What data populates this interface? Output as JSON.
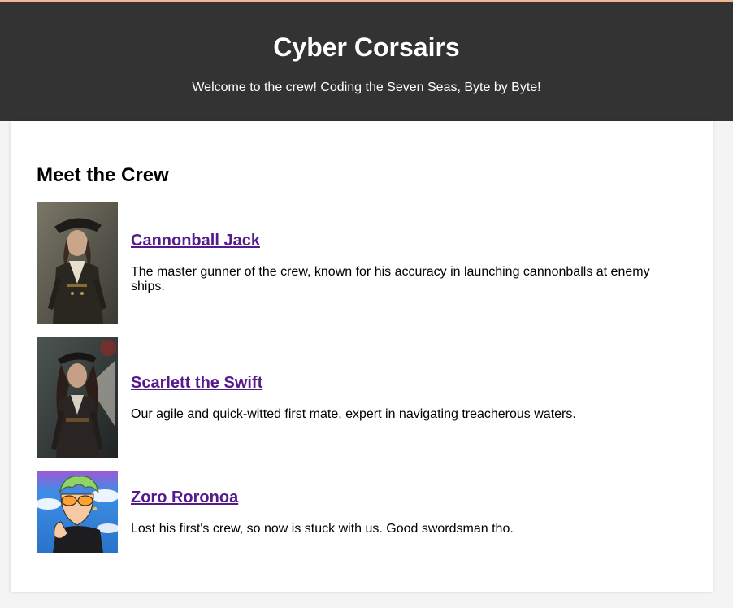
{
  "header": {
    "title": "Cyber Corsairs",
    "tagline": "Welcome to the crew! Coding the Seven Seas, Byte by Byte!"
  },
  "main": {
    "heading": "Meet the Crew",
    "members": [
      {
        "name": "Cannonball Jack",
        "description": "The master gunner of the crew, known for his accuracy in launching cannonballs at enemy ships."
      },
      {
        "name": "Scarlett the Swift",
        "description": "Our agile and quick-witted first mate, expert in navigating treacherous waters."
      },
      {
        "name": "Zoro Roronoa",
        "description": "Lost his first's crew, so now is stuck with us. Good swordsman tho."
      }
    ]
  },
  "colors": {
    "header_bg": "#333333",
    "accent_bar": "#f1b58f",
    "link": "#551a8b",
    "page_bg": "#f4f4f4"
  }
}
